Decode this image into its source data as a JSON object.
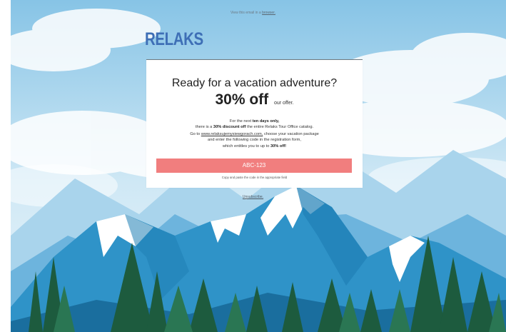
{
  "topbar": {
    "prefix": "View this email in a",
    "link": "browser."
  },
  "brand": {
    "logo": "RELAKS",
    "color": "#3e6fb6"
  },
  "card": {
    "heading": "Ready for a vacation adventure?",
    "offer_big": "30% off",
    "offer_small": "our offer.",
    "line1_a": "For the next",
    "line1_b": "ten days only,",
    "line2_a": "there is a",
    "line2_b": "30% discount off",
    "line2_c": "the entire Relaks Tour Office catalog.",
    "line3_a": "Go to",
    "line3_link": "www.relaksujemysiewgorach.com,",
    "line3_b": "choose your vacation package",
    "line4": "and enter the following code in the registration form,",
    "line5_a": "which entitles you to up to",
    "line5_b": "30% off!",
    "code": "ABC-123",
    "code_color": "#f17e7e",
    "hint": "Copy and paste the code in the appropriate field"
  },
  "footer": {
    "unsubscribe": "Unsubscribe."
  },
  "icons": {
    "background": "mountain-landscape-illustration"
  }
}
